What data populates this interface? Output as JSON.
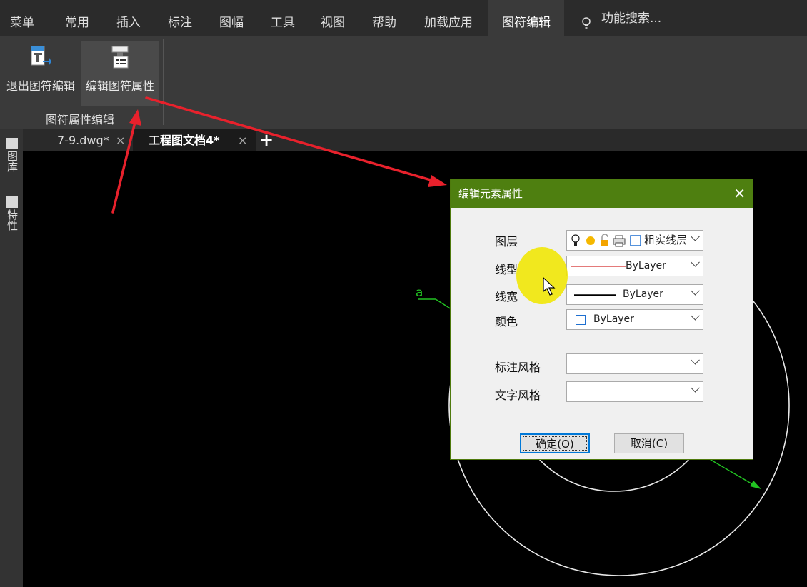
{
  "menubar": {
    "items": [
      "菜单",
      "常用",
      "插入",
      "标注",
      "图幅",
      "工具",
      "视图",
      "帮助",
      "加载应用",
      "图符编辑"
    ],
    "active_index": 9,
    "search_label": "功能搜索..."
  },
  "ribbon": {
    "buttons": [
      "退出图符编辑",
      "编辑图符属性"
    ],
    "group_label": "图符属性编辑"
  },
  "tabs": {
    "docs": [
      "7-9.dwg*",
      "工程图文档4*"
    ],
    "active_index": 1,
    "close_glyph": "×",
    "add_glyph": "+"
  },
  "leftpanel": {
    "tabs": [
      "图库",
      "特性"
    ]
  },
  "canvas": {
    "drawing_label": "a"
  },
  "dialog": {
    "title": "编辑元素属性",
    "close_glyph": "✕",
    "fields": {
      "layer": {
        "label": "图层",
        "value": "粗实线层"
      },
      "linetype": {
        "label": "线型",
        "value": "ByLayer"
      },
      "linewidth": {
        "label": "线宽",
        "value": "ByLayer"
      },
      "color": {
        "label": "颜色",
        "value": "ByLayer"
      },
      "dim_style": {
        "label": "标注风格",
        "value": ""
      },
      "text_style": {
        "label": "文字风格",
        "value": ""
      }
    },
    "ok_label": "确定(O)",
    "cancel_label": "取消(C)"
  },
  "colors": {
    "dialog_title_bar": "#4e7f10",
    "annotation_arrow": "#e8212c",
    "cursor_highlight": "#f0e600",
    "drawing_green": "#22c322"
  }
}
